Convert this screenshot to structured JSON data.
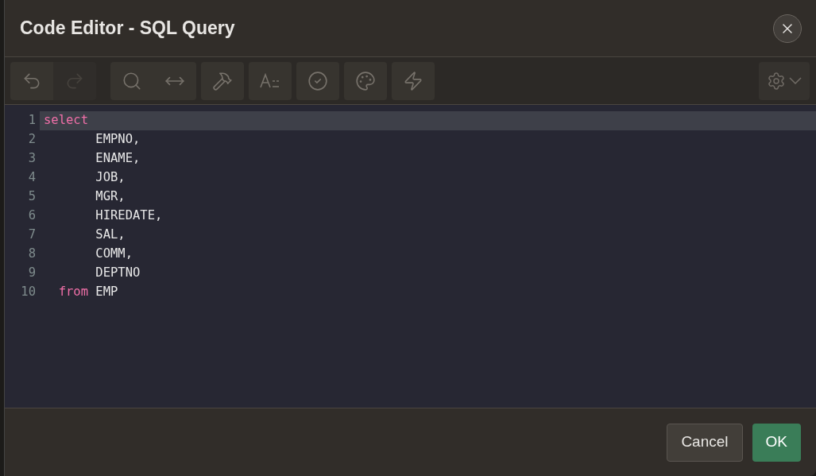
{
  "dialog": {
    "title": "Code Editor - SQL Query"
  },
  "toolbar": {
    "groups": [
      {
        "buttons": [
          {
            "kind": "undo",
            "disabled": false
          },
          {
            "kind": "redo",
            "disabled": true
          }
        ]
      },
      {
        "buttons": [
          {
            "kind": "search",
            "disabled": false
          },
          {
            "kind": "replace",
            "disabled": false
          }
        ]
      },
      {
        "buttons": [
          {
            "kind": "hammer",
            "disabled": false
          }
        ]
      },
      {
        "buttons": [
          {
            "kind": "format",
            "disabled": false
          }
        ]
      },
      {
        "buttons": [
          {
            "kind": "validate",
            "disabled": false
          }
        ]
      },
      {
        "buttons": [
          {
            "kind": "palette",
            "disabled": false
          }
        ]
      },
      {
        "buttons": [
          {
            "kind": "bolt",
            "disabled": false
          }
        ]
      }
    ]
  },
  "editor": {
    "lines": [
      {
        "number": "1",
        "active": true,
        "tokens": [
          {
            "kind": "keyword",
            "text": "select"
          }
        ]
      },
      {
        "number": "2",
        "active": false,
        "tokens": [
          {
            "kind": "plain",
            "text": "       EMPNO,"
          }
        ]
      },
      {
        "number": "3",
        "active": false,
        "tokens": [
          {
            "kind": "plain",
            "text": "       ENAME,"
          }
        ]
      },
      {
        "number": "4",
        "active": false,
        "tokens": [
          {
            "kind": "plain",
            "text": "       JOB,"
          }
        ]
      },
      {
        "number": "5",
        "active": false,
        "tokens": [
          {
            "kind": "plain",
            "text": "       MGR,"
          }
        ]
      },
      {
        "number": "6",
        "active": false,
        "tokens": [
          {
            "kind": "plain",
            "text": "       HIREDATE,"
          }
        ]
      },
      {
        "number": "7",
        "active": false,
        "tokens": [
          {
            "kind": "plain",
            "text": "       SAL,"
          }
        ]
      },
      {
        "number": "8",
        "active": false,
        "tokens": [
          {
            "kind": "plain",
            "text": "       COMM,"
          }
        ]
      },
      {
        "number": "9",
        "active": false,
        "tokens": [
          {
            "kind": "plain",
            "text": "       DEPTNO"
          }
        ]
      },
      {
        "number": "10",
        "active": false,
        "tokens": [
          {
            "kind": "keyword",
            "text": "  from"
          },
          {
            "kind": "plain",
            "text": " EMP"
          }
        ]
      }
    ]
  },
  "buttons": [
    {
      "kind": "secondary",
      "label": "Cancel"
    },
    {
      "kind": "primary",
      "label": "OK"
    }
  ]
}
